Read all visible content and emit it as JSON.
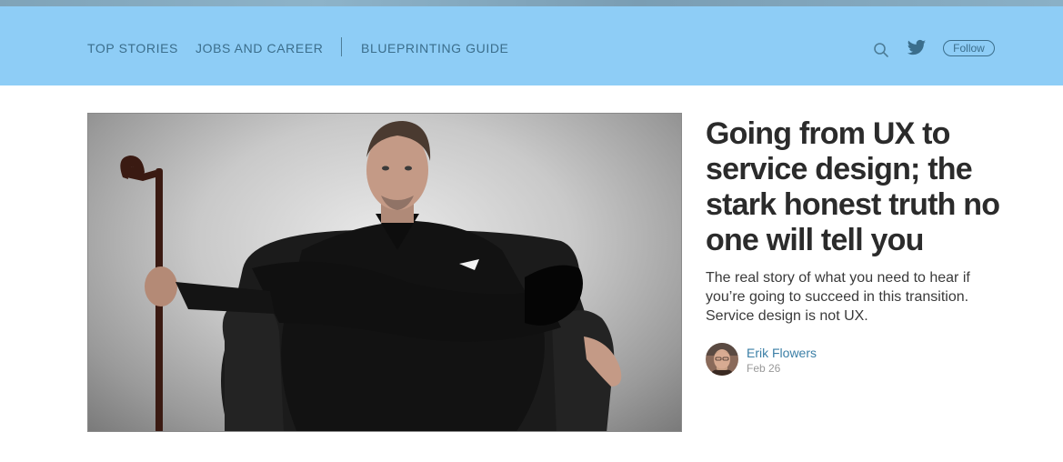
{
  "nav": {
    "links": [
      "Top Stories",
      "Jobs and Career",
      "Blueprinting Guide"
    ],
    "follow_label": "Follow",
    "icons": {
      "search": "search-icon",
      "twitter": "twitter-icon"
    }
  },
  "article": {
    "title": "Going from UX to service design; the stark honest truth no one will tell you",
    "subtitle": "The real story of what you need to hear if you’re going to succeed in this transition. Service design is not UX.",
    "author": "Erik Flowers",
    "date": "Feb 26"
  },
  "colors": {
    "navbar_bg": "#8ecdf6",
    "nav_text": "#3b6e8c",
    "author_link": "#3b7fa6",
    "headline": "#2b2b2b"
  }
}
